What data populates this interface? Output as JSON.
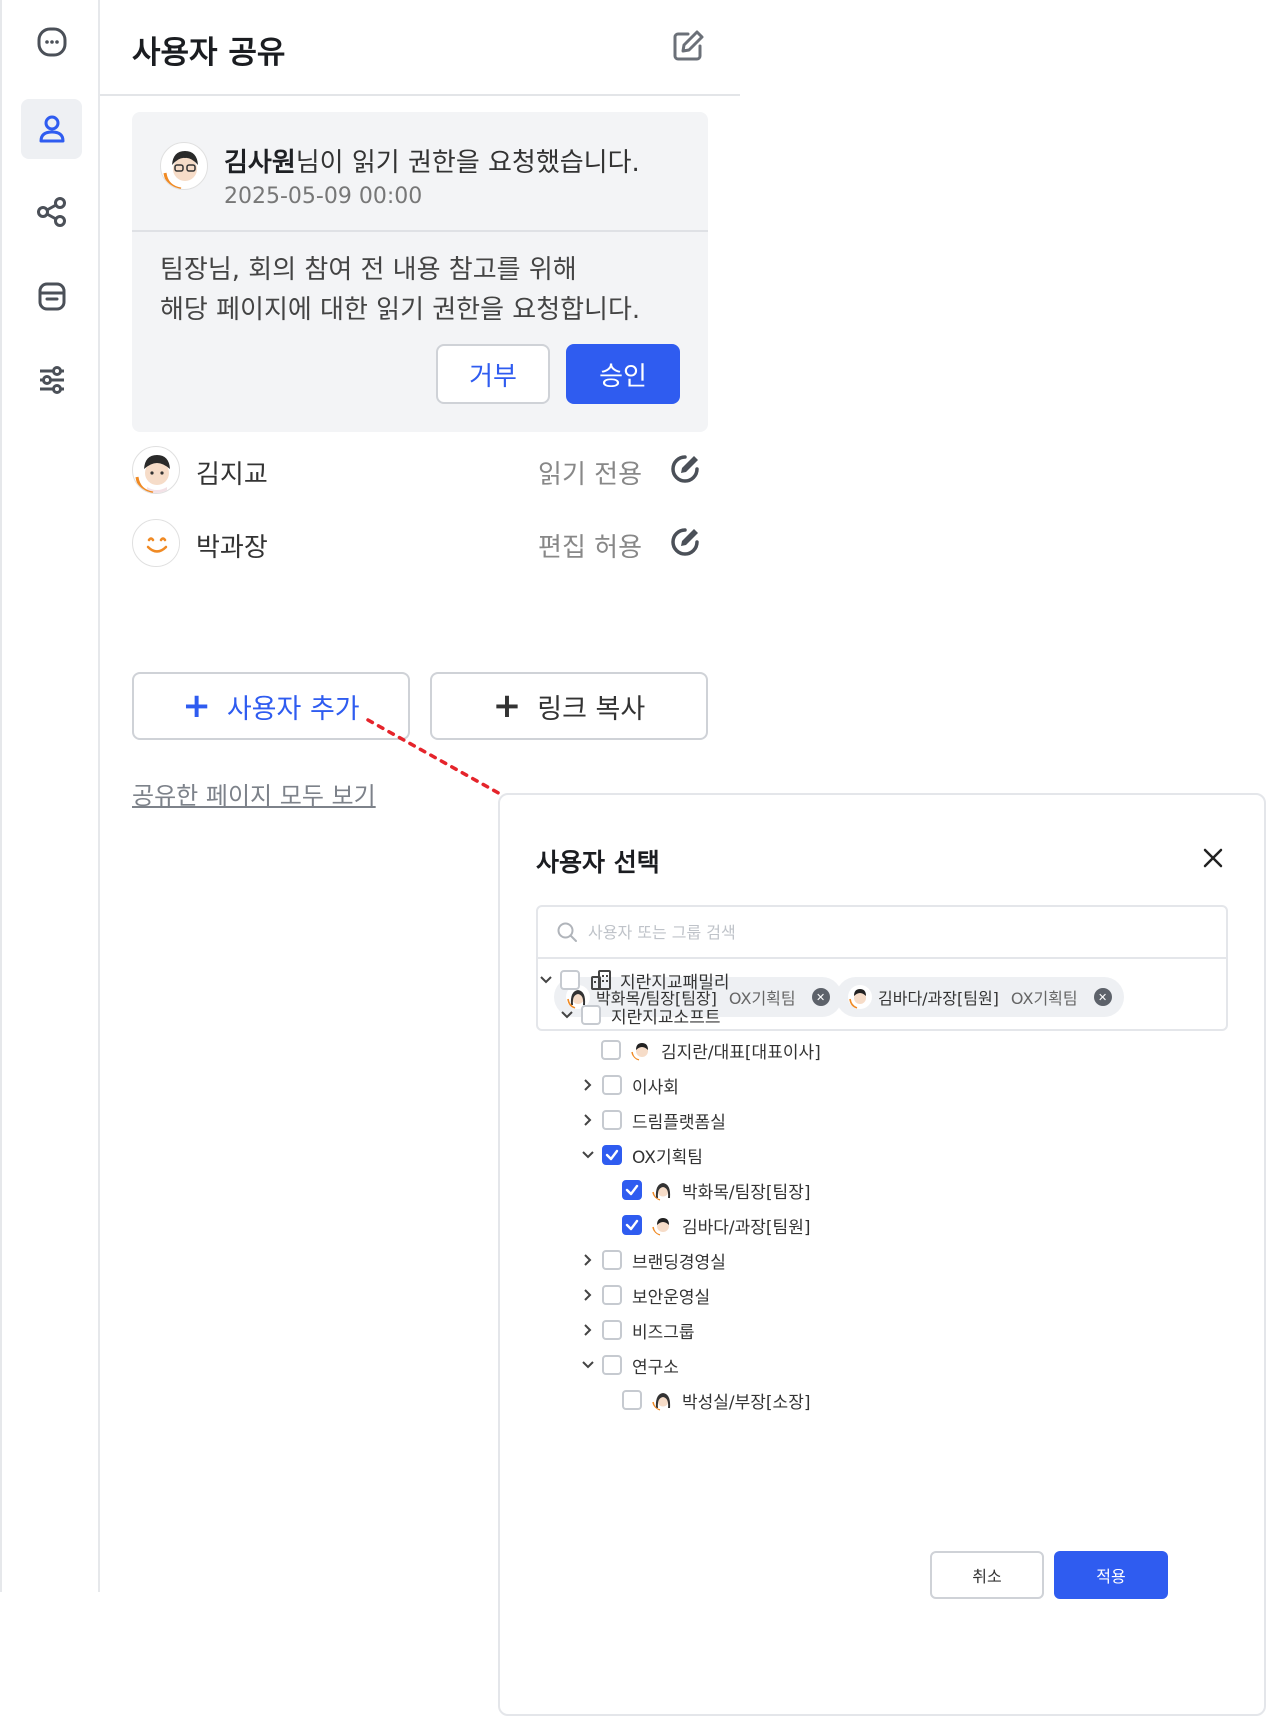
{
  "panel": {
    "title": "사용자 공유"
  },
  "request": {
    "requester": "김사원",
    "request_text": "님이 읽기 권한을 요청했습니다.",
    "date": "2025-05-09 00:00",
    "message": "팀장님, 회의 참여 전 내용 참고를 위해\n해당 페이지에 대한 읽기 권한을 요청합니다.",
    "deny_label": "거부",
    "approve_label": "승인"
  },
  "shared_users": [
    {
      "name": "김지교",
      "permission": "읽기 전용"
    },
    {
      "name": "박과장",
      "permission": "편집 허용"
    }
  ],
  "actions": {
    "add_user": "사용자 추가",
    "copy_link": "링크 복사",
    "view_all": "공유한 페이지 모두 보기"
  },
  "modal": {
    "title": "사용자 선택",
    "search_placeholder": "사용자 또는 그룹 검색",
    "chips": [
      {
        "name": "박화목/팀장[팀장]",
        "team": "OX기획팀"
      },
      {
        "name": "김바다/과장[팀원]",
        "team": "OX기획팀"
      }
    ],
    "tree": [
      {
        "label": "지란지교패밀리"
      },
      {
        "label": "지란지교소프트"
      },
      {
        "label": "김지란/대표[대표이사]"
      },
      {
        "label": "이사회"
      },
      {
        "label": "드림플랫폼실"
      },
      {
        "label": "OX기획팀"
      },
      {
        "label": "박화목/팀장[팀장]"
      },
      {
        "label": "김바다/과장[팀원]"
      },
      {
        "label": "브랜딩경영실"
      },
      {
        "label": "보안운영실"
      },
      {
        "label": "비즈그룹"
      },
      {
        "label": "연구소"
      },
      {
        "label": "박성실/부장[소장]"
      }
    ],
    "cancel_label": "취소",
    "apply_label": "적용"
  },
  "colors": {
    "accent": "#2f5cf0",
    "arrow": "#e5242b"
  }
}
